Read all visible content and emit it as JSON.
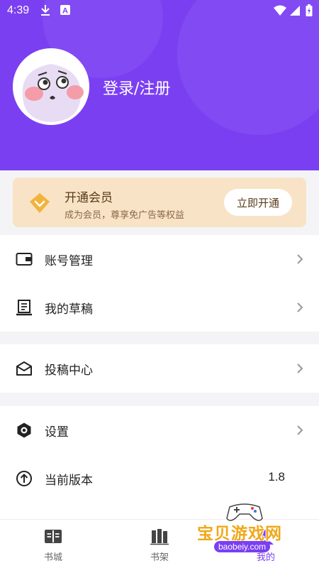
{
  "status_bar": {
    "time": "4:39",
    "icons": [
      "download-icon",
      "a-notification-icon",
      "wifi-icon",
      "signal-icon",
      "battery-charging-icon"
    ]
  },
  "profile": {
    "login_label": "登录/注册",
    "avatar_icon": "cartoon-avatar-icon"
  },
  "vip": {
    "title": "开通会员",
    "subtitle": "成为会员，尊享免广告等权益",
    "button": "立即开通",
    "icon": "diamond-icon"
  },
  "menu_groups": [
    {
      "items": [
        {
          "label": "账号管理",
          "icon": "wallet-icon"
        },
        {
          "label": "我的草稿",
          "icon": "draft-icon"
        }
      ]
    },
    {
      "items": [
        {
          "label": "投稿中心",
          "icon": "envelope-icon"
        }
      ]
    },
    {
      "items": [
        {
          "label": "设置",
          "icon": "settings-icon"
        },
        {
          "label": "当前版本",
          "icon": "arrow-up-circle-icon",
          "value": "1.8"
        }
      ]
    }
  ],
  "bottom_nav": {
    "items": [
      {
        "label": "书城",
        "icon": "bookstore-icon"
      },
      {
        "label": "书架",
        "icon": "bookshelf-icon"
      },
      {
        "label": "我的",
        "icon": "profile-icon",
        "active": true
      }
    ]
  },
  "watermark": {
    "text": "宝贝游戏网",
    "url": "baobeiy.com"
  },
  "colors": {
    "accent": "#7b3ff2",
    "vip_bg": "#f8e3c7",
    "vip_text": "#5a3a1a"
  }
}
